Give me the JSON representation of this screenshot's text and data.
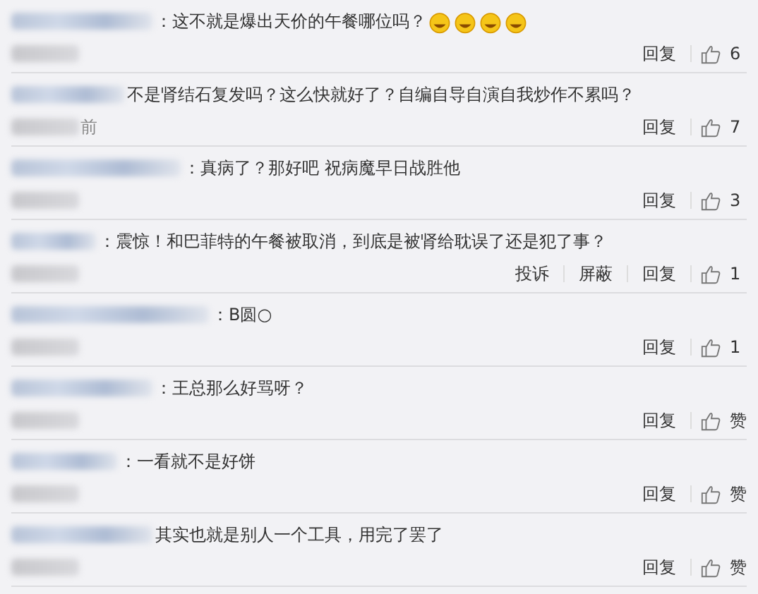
{
  "comments": [
    {
      "text": "：这不就是爆出天价的午餐哪位吗？",
      "emojis": [
        {
          "kind": "grin"
        },
        {
          "kind": "grin"
        },
        {
          "kind": "grin"
        },
        {
          "kind": "grin"
        }
      ],
      "actions": [
        "回复"
      ],
      "likes": "6"
    },
    {
      "text": "不是肾结石复发吗？这么快就好了？自编自导自演自我炒作不累吗？",
      "time": "前",
      "actions": [
        "回复"
      ],
      "likes": "7"
    },
    {
      "text": "：真病了？那好吧 祝病魔早日战胜他",
      "actions": [
        "回复"
      ],
      "likes": "3"
    },
    {
      "text": "：震惊！和巴菲特的午餐被取消，到底是被肾给耽误了还是犯了事？",
      "actions": [
        "投诉",
        "屏蔽",
        "回复"
      ],
      "likes": "1"
    },
    {
      "text": "：B圆○",
      "actions": [
        "回复"
      ],
      "likes": "1"
    },
    {
      "text": "：王总那么好骂呀？",
      "actions": [
        "回复"
      ],
      "likes": "赞"
    },
    {
      "text": "：一看就不是好饼",
      "actions": [
        "回复"
      ],
      "likes": "赞"
    },
    {
      "text": "其实也就是别人一个工具，用完了罢了",
      "actions": [
        "回复"
      ],
      "likes": "赞"
    }
  ]
}
